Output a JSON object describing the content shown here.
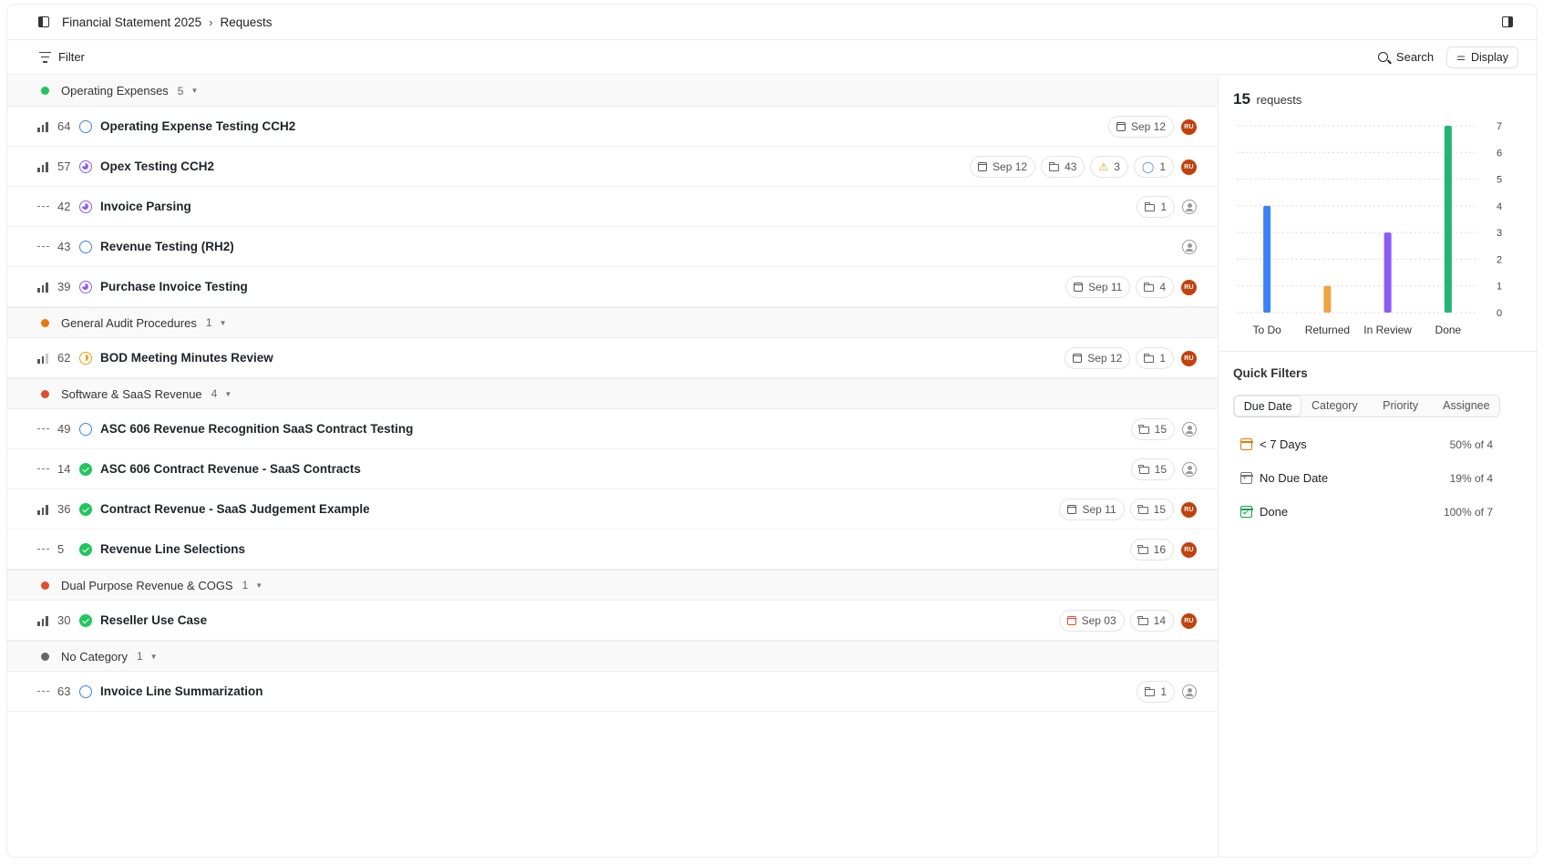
{
  "breadcrumb": {
    "project": "Financial Statement 2025",
    "separator": "›",
    "page": "Requests"
  },
  "toolbar": {
    "filter_label": "Filter",
    "search_label": "Search",
    "display_label": "Display"
  },
  "groups": [
    {
      "name": "Operating Expenses",
      "count": "5",
      "color": "#22c55e",
      "rows": [
        {
          "priority": "high",
          "num": "64",
          "status": "todo",
          "title": "Operating Expense Testing CCH2",
          "date": "Sep 12",
          "files": null,
          "warnings": null,
          "comments": null,
          "assignee": "RU"
        },
        {
          "priority": "high",
          "num": "57",
          "status": "review",
          "title": "Opex Testing CCH2",
          "date": "Sep 12",
          "files": "43",
          "warnings": "3",
          "comments": "1",
          "assignee": "RU"
        },
        {
          "priority": "none",
          "num": "42",
          "status": "review",
          "title": "Invoice Parsing",
          "date": null,
          "files": "1",
          "warnings": null,
          "comments": null,
          "assignee": null
        },
        {
          "priority": "none",
          "num": "43",
          "status": "todo",
          "title": "Revenue Testing (RH2)",
          "date": null,
          "files": null,
          "warnings": null,
          "comments": null,
          "assignee": null
        },
        {
          "priority": "high",
          "num": "39",
          "status": "review",
          "title": "Purchase Invoice Testing",
          "date": "Sep 11",
          "files": "4",
          "warnings": null,
          "comments": null,
          "assignee": "RU"
        }
      ]
    },
    {
      "name": "General Audit Procedures",
      "count": "1",
      "color": "#e9770e",
      "rows": [
        {
          "priority": "medium",
          "num": "62",
          "status": "returned",
          "title": "BOD Meeting Minutes Review",
          "date": "Sep 12",
          "files": "1",
          "warnings": null,
          "comments": null,
          "assignee": "RU"
        }
      ]
    },
    {
      "name": "Software & SaaS Revenue",
      "count": "4",
      "color": "#e04e2f",
      "rows": [
        {
          "priority": "none",
          "num": "49",
          "status": "todo",
          "title": "ASC 606 Revenue Recognition SaaS Contract Testing",
          "date": null,
          "files": "15",
          "warnings": null,
          "comments": null,
          "assignee": null
        },
        {
          "priority": "none",
          "num": "14",
          "status": "done",
          "title": "ASC 606 Contract Revenue - SaaS Contracts",
          "date": null,
          "files": "15",
          "warnings": null,
          "comments": null,
          "assignee": null
        },
        {
          "priority": "high",
          "num": "36",
          "status": "done",
          "title": "Contract Revenue - SaaS Judgement Example",
          "date": "Sep 11",
          "files": "15",
          "warnings": null,
          "comments": null,
          "assignee": "RU"
        },
        {
          "priority": "none",
          "num": "5",
          "status": "done",
          "title": "Revenue Line Selections",
          "date": null,
          "files": "16",
          "warnings": null,
          "comments": null,
          "assignee": "RU"
        }
      ]
    },
    {
      "name": "Dual Purpose Revenue & COGS",
      "count": "1",
      "color": "#e04e2f",
      "rows": [
        {
          "priority": "high",
          "num": "30",
          "status": "done",
          "title": "Reseller Use Case",
          "date": "Sep 03",
          "date_overdue": true,
          "files": "14",
          "warnings": null,
          "comments": null,
          "assignee": "RU"
        }
      ]
    },
    {
      "name": "No Category",
      "count": "1",
      "color": "#666666",
      "rows": [
        {
          "priority": "none",
          "num": "63",
          "status": "todo",
          "title": "Invoice Line Summarization",
          "date": null,
          "files": "1",
          "warnings": null,
          "comments": null,
          "assignee": null
        }
      ]
    }
  ],
  "sidebar": {
    "total_count": "15",
    "total_label": "requests",
    "quick_filters_title": "Quick Filters",
    "tabs": [
      "Due Date",
      "Category",
      "Priority",
      "Assignee"
    ],
    "active_tab": "Due Date",
    "items": [
      {
        "icon": "calendar-clock-icon",
        "label": "< 7 Days",
        "value": "50% of 4"
      },
      {
        "icon": "calendar-plus-icon",
        "label": "No Due Date",
        "value": "19% of 4"
      },
      {
        "icon": "calendar-check-icon",
        "label": "Done",
        "value": "100% of 7"
      }
    ]
  },
  "chart_data": {
    "type": "bar",
    "categories": [
      "To Do",
      "Returned",
      "In Review",
      "Done"
    ],
    "values": [
      4,
      1,
      3,
      7
    ],
    "colors": [
      "#3b82f6",
      "#f0a340",
      "#8b5cf6",
      "#22b573"
    ],
    "ylim": [
      0,
      7
    ],
    "yticks": [
      0,
      1,
      2,
      3,
      4,
      5,
      6,
      7
    ],
    "y_axis_side": "right",
    "grid": true,
    "title": "",
    "xlabel": "",
    "ylabel": ""
  }
}
